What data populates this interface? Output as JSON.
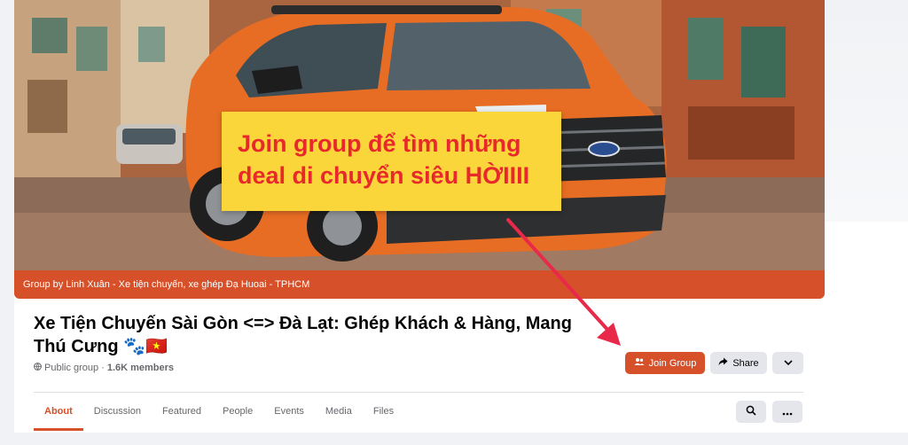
{
  "cover": {
    "promo_line1": "Join group để tìm những",
    "promo_line2": "deal di chuyển siêu HỜIIII",
    "caption": "Group by Linh Xuân - Xe tiện chuyến, xe ghép Đạ Huoai - TPHCM",
    "accent_color": "#d6502a",
    "promo_bg": "#fbd63a",
    "promo_text_color": "#e8292b"
  },
  "group": {
    "title": "Xe Tiện Chuyến Sài Gòn <=> Đà Lạt: Ghép Khách & Hàng, Mang Thú Cưng 🐾🇻🇳",
    "privacy": "Public group",
    "separator": "·",
    "members": "1.6K members"
  },
  "actions": {
    "join_label": "Join Group",
    "share_label": "Share"
  },
  "tabs": [
    {
      "label": "About",
      "active": true
    },
    {
      "label": "Discussion"
    },
    {
      "label": "Featured"
    },
    {
      "label": "People"
    },
    {
      "label": "Events"
    },
    {
      "label": "Media"
    },
    {
      "label": "Files"
    }
  ],
  "icons": [
    "globe-icon",
    "people-icon",
    "share-arrow-icon",
    "chevron-down-icon",
    "search-icon",
    "ellipsis-icon",
    "annotation-arrow"
  ]
}
